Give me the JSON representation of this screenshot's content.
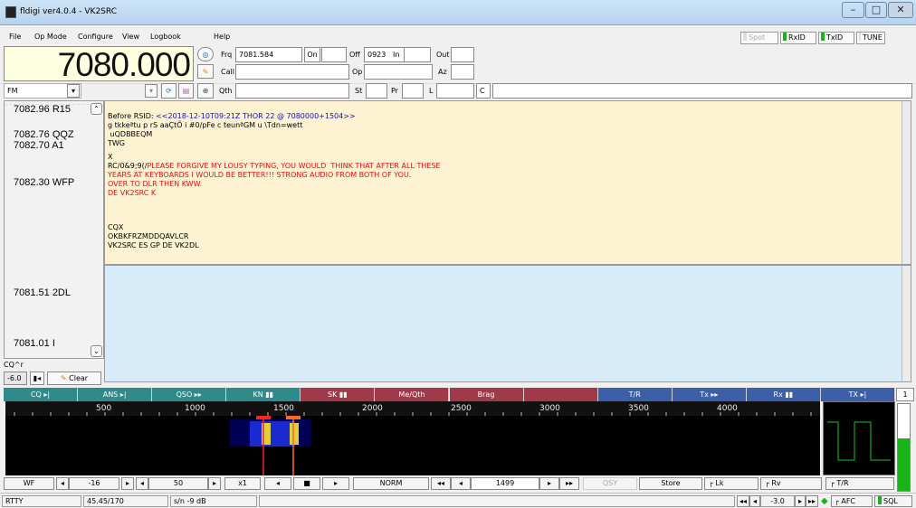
{
  "window": {
    "title": "fldigi ver4.0.4 - VK2SRC",
    "minimize": "–",
    "maximize": "□",
    "close": "✕"
  },
  "menu": {
    "file": "File",
    "opmode": "Op Mode",
    "configure": "Configure",
    "view": "View",
    "logbook": "Logbook",
    "help": "Help"
  },
  "toggles": {
    "spot": "Spot",
    "rxid": "RxID",
    "txid": "TxID",
    "tune": "TUNE"
  },
  "freq_display": "7080.000",
  "log": {
    "frq_label": "Frq",
    "frq_value": "7081.584",
    "on_label": "On",
    "on_value": "",
    "off_label": "Off",
    "off_value": "0923",
    "in_label": "In",
    "in_value": "",
    "out_label": "Out",
    "out_value": "",
    "call_label": "Call",
    "call_value": "",
    "op_label": "Op",
    "op_value": "",
    "az_label": "Az",
    "az_value": "",
    "qth_label": "Qth",
    "qth_value": "",
    "st_label": "St",
    "st_value": "",
    "pr_label": "Pr",
    "pr_value": "",
    "l_label": "L",
    "l_value": "",
    "c_label": "C",
    "c_value": ""
  },
  "mode_select": "FM",
  "left_list": [
    "7082.96 R15",
    "7082.76 QQZ",
    "7082.70 A1",
    "7082.30 WFP",
    "7081.51 2DL",
    "7081.01 I"
  ],
  "cq_label": "CQ^r",
  "clear": {
    "value": "-6.0",
    "label": "Clear"
  },
  "rx_lines": [
    {
      "text": "Before RSID: ",
      "color": "#000"
    },
    {
      "text": "<<2018-12-10T09:21Z THOR 22 @ 7080000+1504>>",
      "color": "#1010c0"
    },
    {
      "text": "g tkkeªtu p rS aaÇtÕ i #0/pFe c teunªGM u \\Tdn=wett",
      "color": "#000"
    },
    {
      "text": " uQDBBEQM",
      "color": "#000"
    },
    {
      "text": "TWG",
      "color": "#000"
    },
    {
      "text": "X",
      "color": "#000"
    },
    {
      "text": "RC/0&9;9(/",
      "color": "#000"
    },
    {
      "text": "PLEASE FORGIVE MY LOUSY TYPING, YOU WOULD  THINK THAT AFTER ALL THESE",
      "color": "#e01010"
    },
    {
      "text": "YEARS AT KEYBOARDS I WOULD BE BETTER!!! STRONG AUDIO FROM BOTH OF YOU.",
      "color": "#e01010"
    },
    {
      "text": "OVER TO DLR THEN KWW.",
      "color": "#e01010"
    },
    {
      "text": "DE VK2SRC K",
      "color": "#e01010"
    },
    {
      "text": "CQX",
      "color": "#000"
    },
    {
      "text": "OKBKFRZMDDQAVLCR",
      "color": "#000"
    },
    {
      "text": "VK2SRC ES GP DE VK2DL",
      "color": "#000"
    }
  ],
  "macros": [
    {
      "label": "CQ ▸|",
      "bg": "#2f8a8a"
    },
    {
      "label": "ANS ▸|",
      "bg": "#2f8a8a"
    },
    {
      "label": "QSO ▸▸",
      "bg": "#2f8a8a"
    },
    {
      "label": "KN ▮▮",
      "bg": "#2f8a8a"
    },
    {
      "label": "SK ▮▮",
      "bg": "#a03a4a"
    },
    {
      "label": "Me/Qth",
      "bg": "#a03a4a"
    },
    {
      "label": "Brag",
      "bg": "#a03a4a"
    },
    {
      "label": "",
      "bg": "#a03a4a"
    },
    {
      "label": "T/R",
      "bg": "#3d5ea8"
    },
    {
      "label": "Tx ▸▸",
      "bg": "#3d5ea8"
    },
    {
      "label": "Rx ▮▮",
      "bg": "#3d5ea8"
    },
    {
      "label": "TX ▸|",
      "bg": "#3d5ea8"
    }
  ],
  "macro_page": "1",
  "scale_ticks": [
    "500",
    "1000",
    "1500",
    "2000",
    "2500",
    "3000",
    "3500",
    "4000"
  ],
  "controls": {
    "wf": "WF",
    "level": "-16",
    "range": "50",
    "zoom": "x1",
    "norm": "NORM",
    "carrier": "1499",
    "qsy": "QSY",
    "store": "Store",
    "lk": "Lk",
    "rv": "Rv",
    "tr": "T/R"
  },
  "status": {
    "mode": "RTTY",
    "rate": "45.45/170",
    "sn": "s/n -9  dB",
    "afc_value": "-3.0",
    "afc": "AFC",
    "sql": "SQL"
  },
  "colors": {
    "freq_bg": "#fefee0",
    "rx_bg": "#fdf3d2",
    "tx_bg": "#d7ebf8",
    "green": "#19b419"
  }
}
